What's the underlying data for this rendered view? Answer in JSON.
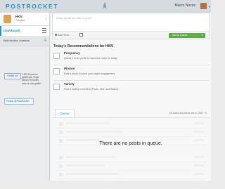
{
  "header": {
    "logo": "POSTROCKET",
    "user_name": "Marco Nozze",
    "dropdown_glyph": "▾"
  },
  "sidebar": {
    "account": {
      "name": "HKN",
      "subtitle": "796 likes"
    },
    "items": [
      {
        "label": "Dashboard",
        "icon": "list-icon"
      },
      {
        "label": "Optimization Analysis",
        "icon": "bars-icon"
      }
    ],
    "facebook": {
      "like_label": "Gefällt mir",
      "text": "1.828 Personen gefällt das. Zeige deinen Freunden, dass dir das gefällt."
    },
    "twitter": {
      "follow_label": "Follow @PostRocket"
    }
  },
  "composer": {
    "placeholder": "What would you like to post?",
    "add_photo": "Add Photo",
    "queue_button": "Add to Queue"
  },
  "recommendations": {
    "title": "Today's Recommendations for HKN",
    "items": [
      {
        "title": "Frequency",
        "desc": "Queue 1 more posts to maximize reach for today."
      },
      {
        "title": "Photos",
        "desc": "Post a photo to boost your page's engagement."
      },
      {
        "title": "Variety",
        "desc": "Post a variety of content (Photo, Link, and Status)."
      }
    ]
  },
  "queue": {
    "tab": "Queue",
    "timezone": "All dates and times are in GMT +1",
    "empty_message": "There are no posts in queue."
  },
  "colors": {
    "brand": "#2e8fc5",
    "queue_button": "#5aae3a"
  }
}
